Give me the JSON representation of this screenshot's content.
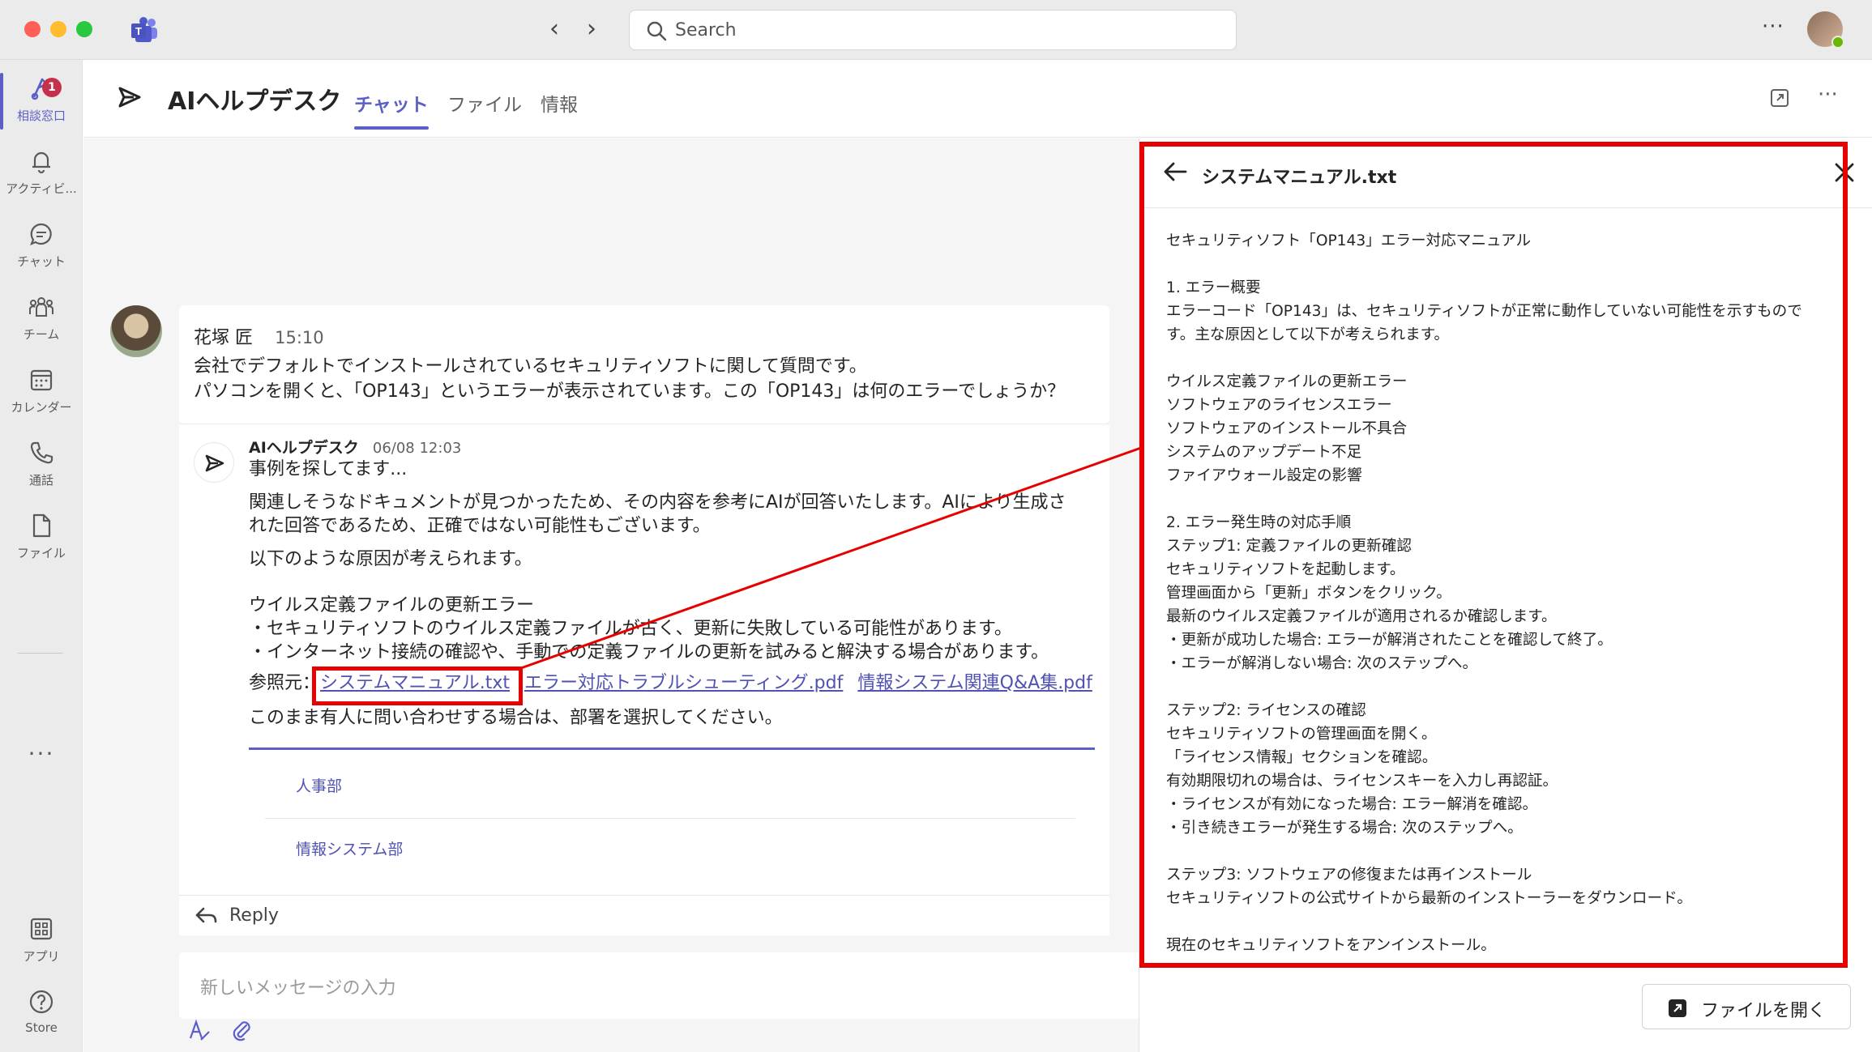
{
  "titlebar": {
    "search_placeholder": "Search",
    "more_icon": "more-horizontal-icon"
  },
  "rail": {
    "items": [
      {
        "label": "相談窓口",
        "icon": "bot-icon",
        "badge": "1",
        "active": true
      },
      {
        "label": "アクティビ...",
        "icon": "bell-icon"
      },
      {
        "label": "チャット",
        "icon": "chat-icon"
      },
      {
        "label": "チーム",
        "icon": "teams-icon"
      },
      {
        "label": "カレンダー",
        "icon": "calendar-icon"
      },
      {
        "label": "通話",
        "icon": "phone-icon"
      },
      {
        "label": "ファイル",
        "icon": "file-icon"
      }
    ],
    "more": "···",
    "bottom": [
      {
        "label": "アプリ",
        "icon": "apps-icon"
      },
      {
        "label": "Store",
        "icon": "help-icon"
      }
    ]
  },
  "header": {
    "title": "AIヘルプデスク",
    "tabs": [
      {
        "label": "チャット",
        "active": true
      },
      {
        "label": "ファイル"
      },
      {
        "label": "情報"
      }
    ]
  },
  "conversation": {
    "user_message": {
      "name": "花塚 匠",
      "time": "15:10",
      "lines": [
        "会社でデフォルトでインストールされているセキュリティソフトに関して質問です。",
        "パソコンを開くと、「OP143」というエラーが表示されています。この「OP143」は何のエラーでしょうか？"
      ]
    },
    "bot_message": {
      "name": "AIヘルプデスク",
      "time": "06/08 12:03",
      "searching": "事例を探してます...",
      "intro_lines": [
        "関連しそうなドキュメントが見つかったため、その内容を参考にAIが回答いたします。AIにより生成さ",
        "れた回答であるため、正確ではない可能性もございます。"
      ],
      "causes_intro": "以下のような原因が考えられます。",
      "cause_title": "ウイルス定義ファイルの更新エラー",
      "cause_points": [
        "・セキュリティソフトのウイルス定義ファイルが古く、更新に失敗している可能性があります。",
        "・インターネット接続の確認や、手動での定義ファイルの更新を試みると解決する場合があります。"
      ],
      "references_label": "参照元：",
      "references": [
        "システムマニュアル.txt",
        "エラー対応トラブルシューティング.pdf",
        "情報システム関連Q&A集.pdf"
      ],
      "escalation": "このまま有人に問い合わせする場合は、部署を選択してください。",
      "departments": [
        "人事部",
        "情報システム部"
      ]
    },
    "reply_label": "Reply",
    "compose_placeholder": "新しいメッセージの入力"
  },
  "viewer": {
    "title": "システムマニュアル.txt",
    "lines": [
      "セキュリティソフト「OP143」エラー対応マニュアル",
      "",
      "1. エラー概要",
      "エラーコード「OP143」は、セキュリティソフトが正常に動作していない可能性を示すもので",
      "す。主な原因として以下が考えられます。",
      "",
      "ウイルス定義ファイルの更新エラー",
      "ソフトウェアのライセンスエラー",
      "ソフトウェアのインストール不具合",
      "システムのアップデート不足",
      "ファイアウォール設定の影響",
      "",
      "2. エラー発生時の対応手順",
      "ステップ1: 定義ファイルの更新確認",
      "セキュリティソフトを起動します。",
      "管理画面から「更新」ボタンをクリック。",
      "最新のウイルス定義ファイルが適用されるか確認します。",
      "・更新が成功した場合: エラーが解消されたことを確認して終了。",
      "・エラーが解消しない場合: 次のステップへ。",
      "",
      "ステップ2: ライセンスの確認",
      "セキュリティソフトの管理画面を開く。",
      "「ライセンス情報」セクションを確認。",
      "有効期限切れの場合は、ライセンスキーを入力し再認証。",
      "・ライセンスが有効になった場合: エラー解消を確認。",
      "・引き続きエラーが発生する場合: 次のステップへ。",
      "",
      "ステップ3: ソフトウェアの修復または再インストール",
      "セキュリティソフトの公式サイトから最新のインストーラーをダウンロード。",
      "",
      "現在のセキュリティソフトをアンインストール。"
    ],
    "open_button": "ファイルを開く"
  },
  "colors": {
    "accent": "#5b5fc7",
    "highlight": "#e60000",
    "link": "#4f52b2"
  }
}
